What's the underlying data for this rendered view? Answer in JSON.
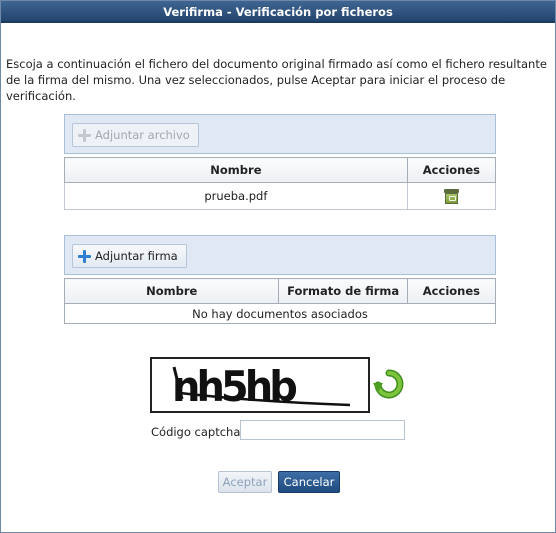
{
  "window": {
    "title": "Verifirma - Verificación por ficheros"
  },
  "intro_text": "Escoja a continuación el fichero del documento original firmado así como el fichero resultante de la firma del mismo. Una vez seleccionados, pulse Aceptar para iniciar el proceso de verificación.",
  "document_panel": {
    "attach_button": {
      "label": "Adjuntar archivo",
      "enabled": false,
      "icon": "plus-icon"
    },
    "columns": [
      "Nombre",
      "Acciones"
    ],
    "rows": [
      {
        "name": "prueba.pdf",
        "action_icon": "archive-icon"
      }
    ]
  },
  "signature_panel": {
    "attach_button": {
      "label": "Adjuntar firma",
      "enabled": true,
      "icon": "plus-icon"
    },
    "columns": [
      "Nombre",
      "Formato de firma",
      "Acciones"
    ],
    "empty_text": "No hay documentos asociados"
  },
  "captcha": {
    "image_text": "nh5hb",
    "refresh_icon": "refresh-arrow-icon",
    "label": "Código captcha",
    "value": ""
  },
  "buttons": {
    "accept": {
      "label": "Aceptar",
      "enabled": false
    },
    "cancel": {
      "label": "Cancelar",
      "enabled": true
    }
  },
  "colors": {
    "title_bar": "#2f5683",
    "panel_bg": "#dfe8f3",
    "cancel_button": "#2a5a90",
    "refresh_icon": "#5aa62a"
  }
}
